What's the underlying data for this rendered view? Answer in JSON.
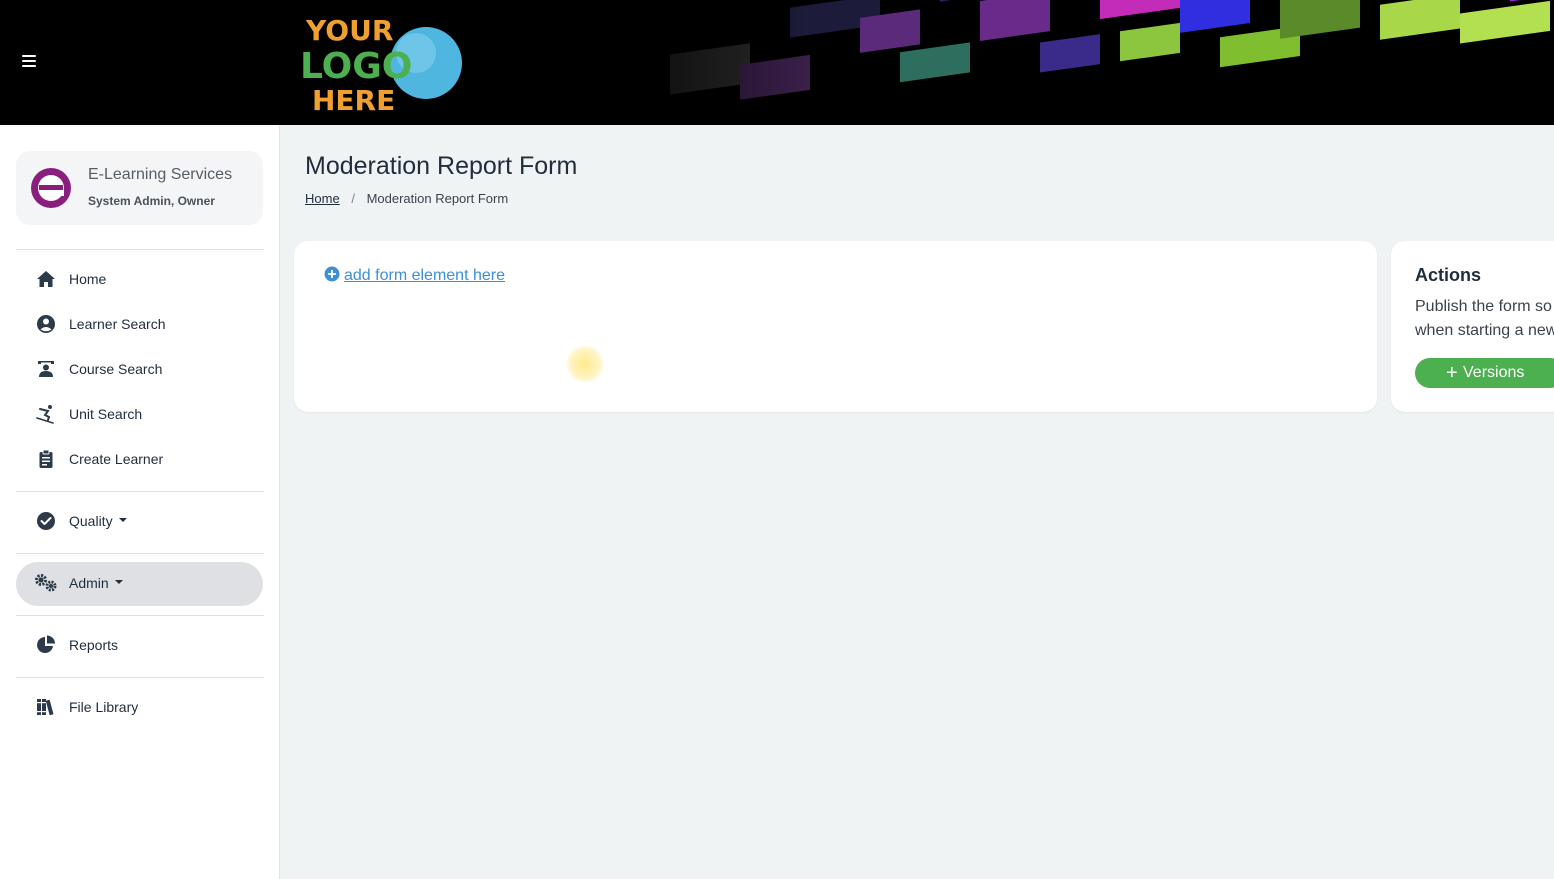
{
  "header": {
    "menu_icon": "hamburger-icon",
    "logo_lines": [
      "YOUR",
      "LOGO",
      "HERE"
    ]
  },
  "sidebar": {
    "org": {
      "name": "E-Learning Services",
      "role": "System Admin, Owner"
    },
    "items": [
      {
        "label": "Home",
        "icon": "home-icon"
      },
      {
        "label": "Learner Search",
        "icon": "user-circle-icon"
      },
      {
        "label": "Course Search",
        "icon": "teacher-icon"
      },
      {
        "label": "Unit Search",
        "icon": "skiing-icon"
      },
      {
        "label": "Create Learner",
        "icon": "clipboard-icon"
      },
      {
        "label": "Quality",
        "icon": "check-circle-icon"
      },
      {
        "label": "Admin",
        "icon": "cogs-icon"
      },
      {
        "label": "Reports",
        "icon": "pie-chart-icon"
      },
      {
        "label": "File Library",
        "icon": "books-icon"
      }
    ]
  },
  "main": {
    "title": "Moderation Report Form",
    "breadcrumb": {
      "home": "Home",
      "divider": "/",
      "current": "Moderation Report Form"
    },
    "add_element_link": "add form element here"
  },
  "actions": {
    "title": "Actions",
    "line1": "Publish the form so",
    "line2": "when starting a new",
    "versions_plus": "+",
    "versions_label": "Versions"
  },
  "colors": {
    "accent_green": "#4caf50",
    "link_blue": "#3d8fd6",
    "text_dark": "#1f2d3d"
  }
}
